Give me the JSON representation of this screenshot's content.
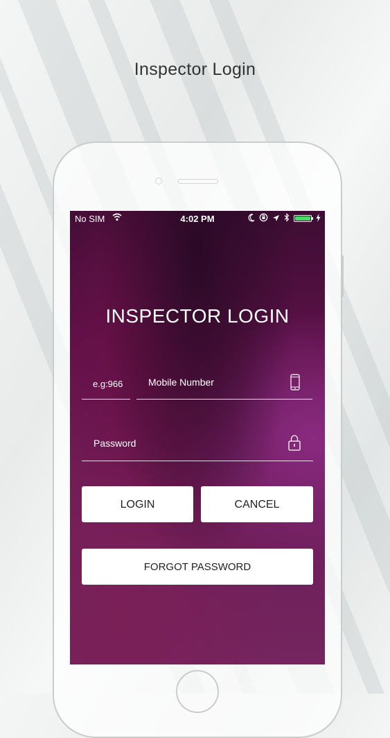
{
  "page": {
    "title": "Inspector Login"
  },
  "status_bar": {
    "carrier": "No SIM",
    "time": "4:02 PM",
    "battery_level": 1.0,
    "icons": [
      "wifi-icon",
      "moon-icon",
      "orientation-lock-icon",
      "location-arrow-icon",
      "bluetooth-icon",
      "battery-icon",
      "charging-icon"
    ]
  },
  "login": {
    "heading": "INSPECTOR LOGIN",
    "country_code_placeholder": "e.g:966",
    "mobile_placeholder": "Mobile Number",
    "password_placeholder": "Password",
    "login_button": "LOGIN",
    "cancel_button": "CANCEL",
    "forgot_button": "FORGOT PASSWORD"
  },
  "colors": {
    "screen_gradient": [
      "#3d0d34",
      "#6b1c58",
      "#74255e"
    ],
    "battery": "#4cd964",
    "button_bg": "#ffffff"
  }
}
